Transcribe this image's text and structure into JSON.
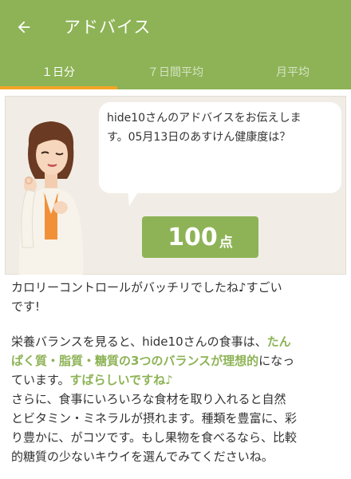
{
  "header": {
    "title": "アドバイス",
    "back_icon": "arrow-back-icon"
  },
  "tabs": [
    {
      "label": "１日分",
      "active": true
    },
    {
      "label": "７日間平均",
      "active": false
    },
    {
      "label": "月平均",
      "active": false
    }
  ],
  "colors": {
    "brand": "#8db356",
    "tab_indicator": "#f2a524",
    "highlight": "#8db356"
  },
  "advisor": {
    "icon": "advisor-avatar",
    "bubble_line1": "hide10さんのアドバイスをお伝えしま",
    "bubble_line2": "す。05月13日のあすけん健康度は？"
  },
  "score": {
    "value": "100",
    "unit": "点"
  },
  "advice": {
    "p1_line1": "カロリーコントロールがバッチリでしたね♪すごい",
    "p1_line2": "です!",
    "p2_a": "栄養バランスを見ると、hide10さんの食事は、",
    "p2_hl1a": "たん",
    "p2_hl1b": "ぱく質・脂質・糖質の3つのバランスが理想的",
    "p2_b": "になっ",
    "p2_c": "ています。",
    "p2_hl2": "すばらしいですね♪",
    "p3_line1": "さらに、食事にいろいろな食材を取り入れると自然",
    "p3_line2": "とビタミン・ミネラルが摂れます。種類を豊富に、彩",
    "p3_line3": "り豊かに、がコツです。もし果物を食べるなら、比較",
    "p3_line4": "的糖質の少ないキウイを選んでみてくださいね。"
  }
}
